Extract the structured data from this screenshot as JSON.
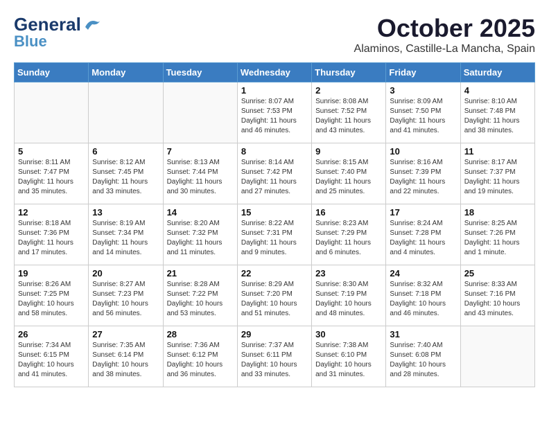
{
  "header": {
    "logo_general": "General",
    "logo_blue": "Blue",
    "month_title": "October 2025",
    "location": "Alaminos, Castille-La Mancha, Spain"
  },
  "weekdays": [
    "Sunday",
    "Monday",
    "Tuesday",
    "Wednesday",
    "Thursday",
    "Friday",
    "Saturday"
  ],
  "weeks": [
    [
      {
        "day": "",
        "text": ""
      },
      {
        "day": "",
        "text": ""
      },
      {
        "day": "",
        "text": ""
      },
      {
        "day": "1",
        "text": "Sunrise: 8:07 AM\nSunset: 7:53 PM\nDaylight: 11 hours\nand 46 minutes."
      },
      {
        "day": "2",
        "text": "Sunrise: 8:08 AM\nSunset: 7:52 PM\nDaylight: 11 hours\nand 43 minutes."
      },
      {
        "day": "3",
        "text": "Sunrise: 8:09 AM\nSunset: 7:50 PM\nDaylight: 11 hours\nand 41 minutes."
      },
      {
        "day": "4",
        "text": "Sunrise: 8:10 AM\nSunset: 7:48 PM\nDaylight: 11 hours\nand 38 minutes."
      }
    ],
    [
      {
        "day": "5",
        "text": "Sunrise: 8:11 AM\nSunset: 7:47 PM\nDaylight: 11 hours\nand 35 minutes."
      },
      {
        "day": "6",
        "text": "Sunrise: 8:12 AM\nSunset: 7:45 PM\nDaylight: 11 hours\nand 33 minutes."
      },
      {
        "day": "7",
        "text": "Sunrise: 8:13 AM\nSunset: 7:44 PM\nDaylight: 11 hours\nand 30 minutes."
      },
      {
        "day": "8",
        "text": "Sunrise: 8:14 AM\nSunset: 7:42 PM\nDaylight: 11 hours\nand 27 minutes."
      },
      {
        "day": "9",
        "text": "Sunrise: 8:15 AM\nSunset: 7:40 PM\nDaylight: 11 hours\nand 25 minutes."
      },
      {
        "day": "10",
        "text": "Sunrise: 8:16 AM\nSunset: 7:39 PM\nDaylight: 11 hours\nand 22 minutes."
      },
      {
        "day": "11",
        "text": "Sunrise: 8:17 AM\nSunset: 7:37 PM\nDaylight: 11 hours\nand 19 minutes."
      }
    ],
    [
      {
        "day": "12",
        "text": "Sunrise: 8:18 AM\nSunset: 7:36 PM\nDaylight: 11 hours\nand 17 minutes."
      },
      {
        "day": "13",
        "text": "Sunrise: 8:19 AM\nSunset: 7:34 PM\nDaylight: 11 hours\nand 14 minutes."
      },
      {
        "day": "14",
        "text": "Sunrise: 8:20 AM\nSunset: 7:32 PM\nDaylight: 11 hours\nand 11 minutes."
      },
      {
        "day": "15",
        "text": "Sunrise: 8:22 AM\nSunset: 7:31 PM\nDaylight: 11 hours\nand 9 minutes."
      },
      {
        "day": "16",
        "text": "Sunrise: 8:23 AM\nSunset: 7:29 PM\nDaylight: 11 hours\nand 6 minutes."
      },
      {
        "day": "17",
        "text": "Sunrise: 8:24 AM\nSunset: 7:28 PM\nDaylight: 11 hours\nand 4 minutes."
      },
      {
        "day": "18",
        "text": "Sunrise: 8:25 AM\nSunset: 7:26 PM\nDaylight: 11 hours\nand 1 minute."
      }
    ],
    [
      {
        "day": "19",
        "text": "Sunrise: 8:26 AM\nSunset: 7:25 PM\nDaylight: 10 hours\nand 58 minutes."
      },
      {
        "day": "20",
        "text": "Sunrise: 8:27 AM\nSunset: 7:23 PM\nDaylight: 10 hours\nand 56 minutes."
      },
      {
        "day": "21",
        "text": "Sunrise: 8:28 AM\nSunset: 7:22 PM\nDaylight: 10 hours\nand 53 minutes."
      },
      {
        "day": "22",
        "text": "Sunrise: 8:29 AM\nSunset: 7:20 PM\nDaylight: 10 hours\nand 51 minutes."
      },
      {
        "day": "23",
        "text": "Sunrise: 8:30 AM\nSunset: 7:19 PM\nDaylight: 10 hours\nand 48 minutes."
      },
      {
        "day": "24",
        "text": "Sunrise: 8:32 AM\nSunset: 7:18 PM\nDaylight: 10 hours\nand 46 minutes."
      },
      {
        "day": "25",
        "text": "Sunrise: 8:33 AM\nSunset: 7:16 PM\nDaylight: 10 hours\nand 43 minutes."
      }
    ],
    [
      {
        "day": "26",
        "text": "Sunrise: 7:34 AM\nSunset: 6:15 PM\nDaylight: 10 hours\nand 41 minutes."
      },
      {
        "day": "27",
        "text": "Sunrise: 7:35 AM\nSunset: 6:14 PM\nDaylight: 10 hours\nand 38 minutes."
      },
      {
        "day": "28",
        "text": "Sunrise: 7:36 AM\nSunset: 6:12 PM\nDaylight: 10 hours\nand 36 minutes."
      },
      {
        "day": "29",
        "text": "Sunrise: 7:37 AM\nSunset: 6:11 PM\nDaylight: 10 hours\nand 33 minutes."
      },
      {
        "day": "30",
        "text": "Sunrise: 7:38 AM\nSunset: 6:10 PM\nDaylight: 10 hours\nand 31 minutes."
      },
      {
        "day": "31",
        "text": "Sunrise: 7:40 AM\nSunset: 6:08 PM\nDaylight: 10 hours\nand 28 minutes."
      },
      {
        "day": "",
        "text": ""
      }
    ]
  ]
}
